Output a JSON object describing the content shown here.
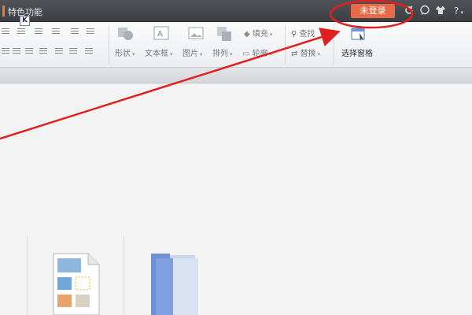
{
  "titlebar": {
    "title": "特色功能",
    "login_label": "未登录",
    "icons": [
      "refresh-icon",
      "chat-icon",
      "skin-icon",
      "help-icon"
    ],
    "help_label": "?",
    "shortcut_badge": "K"
  },
  "ribbon": {
    "shape_label": "形状",
    "textbox_label": "文本框",
    "image_label": "图片",
    "arrange_label": "排列",
    "fill_label": "填充",
    "outline_label": "轮廓",
    "find_label": "查找",
    "replace_label": "替换",
    "selection_pane_label": "选择窗格"
  },
  "colors": {
    "accent": "#f07a2a",
    "login_bg": "#e86a48",
    "annotation": "#e02020"
  }
}
